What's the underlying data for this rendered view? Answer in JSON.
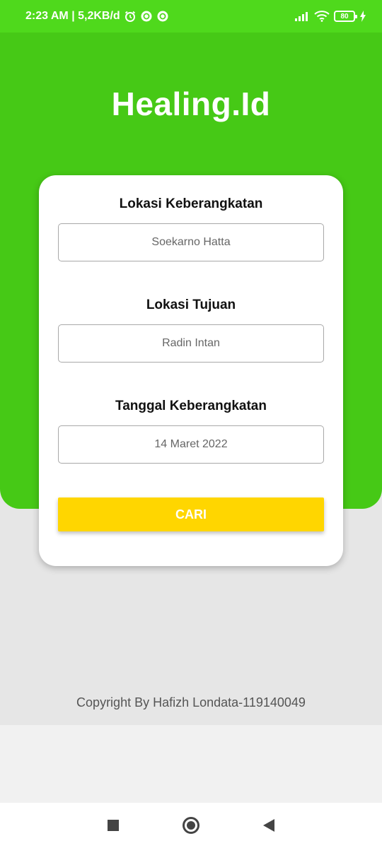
{
  "status_bar": {
    "time_speed": "2:23 AM | 5,2KB/d",
    "battery": "80",
    "icons": [
      "alarm-icon",
      "sync-icon",
      "sync-icon",
      "signal-icon",
      "wifi-icon",
      "battery-icon",
      "charging-icon"
    ]
  },
  "app": {
    "title": "Healing.Id",
    "brand_color": "#46c916",
    "accent_color": "#ffd600"
  },
  "form": {
    "departure": {
      "label": "Lokasi Keberangkatan",
      "value": "Soekarno Hatta"
    },
    "destination": {
      "label": "Lokasi Tujuan",
      "value": "Radin Intan"
    },
    "date": {
      "label": "Tanggal Keberangkatan",
      "value": "14 Maret 2022"
    },
    "search_button": "CARI"
  },
  "footer": {
    "copyright": "Copyright By Hafizh Londata-119140049"
  },
  "nav_bar": {
    "icons": [
      "recents-icon",
      "home-icon",
      "back-icon"
    ]
  }
}
